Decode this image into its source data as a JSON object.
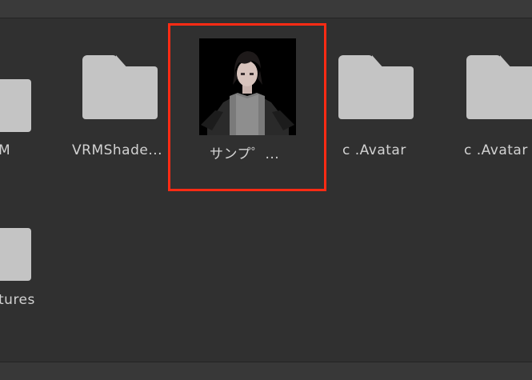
{
  "assets": [
    {
      "label": "M"
    },
    {
      "label": "VRMShade..."
    },
    {
      "label": "サンプ゜..."
    },
    {
      "label": "c .Avatar"
    },
    {
      "label": "c .Avatar"
    },
    {
      "label": "tures"
    }
  ],
  "highlight_color": "#ff2b14",
  "icons": {
    "folder": "folder-icon",
    "thumbnail": "avatar-thumbnail-icon"
  }
}
